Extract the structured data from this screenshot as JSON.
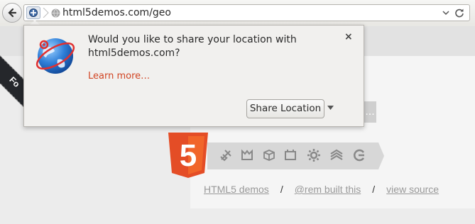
{
  "browser": {
    "url": "html5demos.com/geo"
  },
  "popup": {
    "message": "Would you like to share your location with html5demos.com?",
    "learn_more": "Learn more…",
    "share_button": "Share Location",
    "close_symbol": "×"
  },
  "page": {
    "ribbon_text": "Fork me on GitHub",
    "ribbon_visible_text": "Fo",
    "logo_text": "5",
    "small_button_text": "...",
    "icons": [
      "connectivity-icon",
      "3d-effects-icon",
      "device-access-icon",
      "multimedia-icon",
      "performance-icon",
      "semantics-icon",
      "css3-styling-icon"
    ],
    "footer": {
      "link1": "HTML5 demos",
      "sep": "/",
      "link2": "@rem built this",
      "link3": "view source"
    }
  },
  "colors": {
    "accent": "#d14422",
    "html5_orange": "#e44d26"
  }
}
